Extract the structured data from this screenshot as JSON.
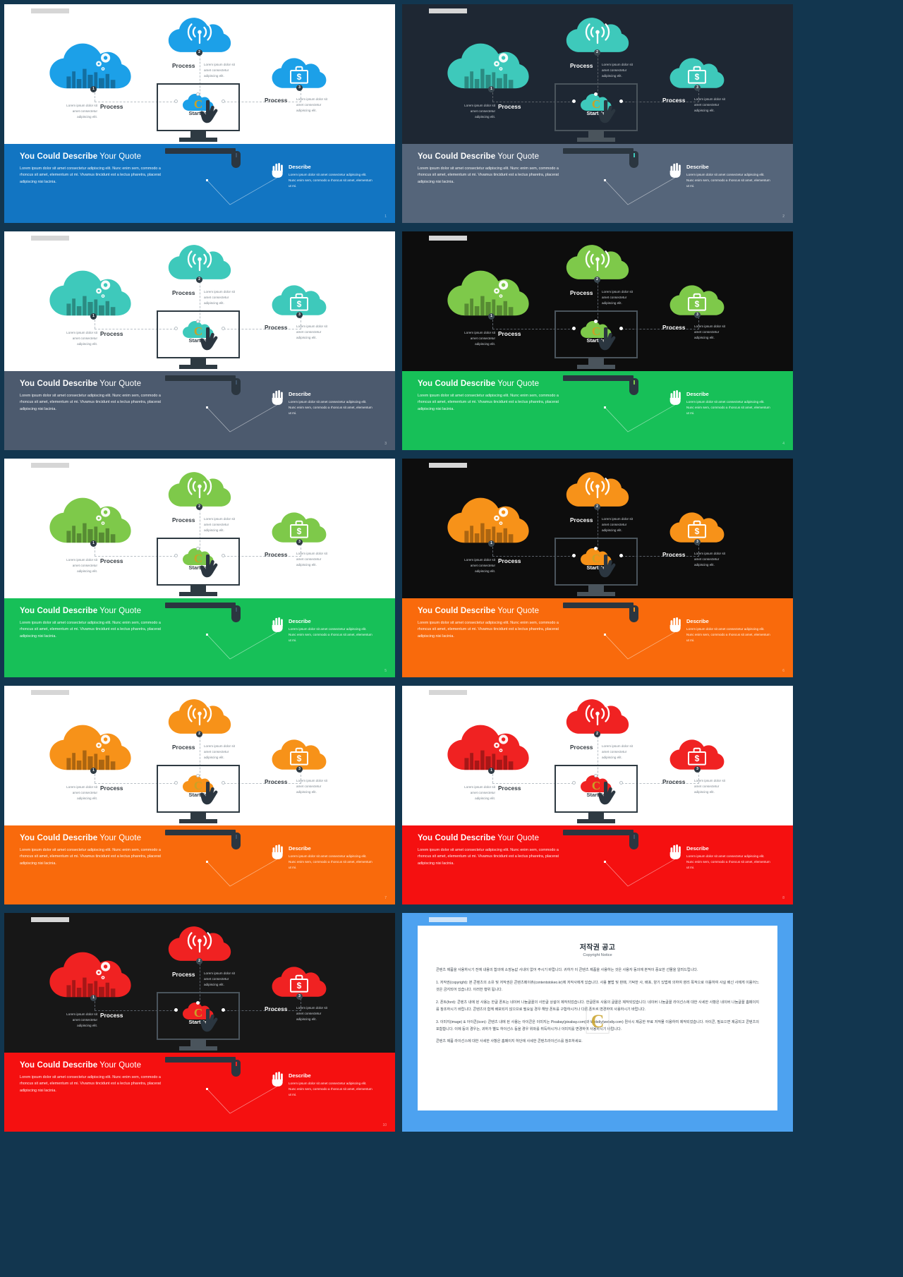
{
  "meta": {
    "background": "#12364f",
    "grid": {
      "columns": 2,
      "rows": 5,
      "total_slides": 10
    }
  },
  "common": {
    "quote": {
      "title_bold": "You Could Describe",
      "title_rest": " Your Quote",
      "body": "Lorem ipsum dolor sit amet consectetur adipiscing elit. Nunc enim sem, commodo a rhoncus sit amet, elementum ut mi. Vivamus tincidunt est a lectus pharetra, placerat adipiscing nisi lacinia."
    },
    "describe": {
      "title": "Describe",
      "body": "Lorem ipsum dolor sit amet consectetur adipiscing elit. Nunc enim sem, commodo a rhoncus sit amet, elementum ut mi.",
      "icon": "hand-icon"
    },
    "monitor_label": "StartUp",
    "monitor_logo": "C",
    "processes": [
      {
        "number": "1",
        "label": "Process",
        "body": "Lorem ipsum dolor sit amet consectetur adipiscing elit.",
        "icon": "gears-city-cloud-icon"
      },
      {
        "number": "2",
        "label": "Process",
        "body": "Lorem ipsum dolor sit amet consectetur adipiscing elit.",
        "icon": "wifi-signal-cloud-icon"
      },
      {
        "number": "3",
        "label": "Process",
        "body": "Lorem ipsum dolor sit amet consectetur adipiscing elit.",
        "icon": "briefcase-dollar-cloud-icon"
      }
    ]
  },
  "slides": [
    {
      "n": 1,
      "theme": "light",
      "canvas_bg": "#ffffff",
      "band_bg": "#1275c2",
      "accent": "#1ca0e8",
      "page": "1"
    },
    {
      "n": 2,
      "theme": "dark",
      "canvas_bg": "#1e2733",
      "band_bg": "#55657a",
      "accent": "#3ec9bb",
      "page": "2"
    },
    {
      "n": 3,
      "theme": "light",
      "canvas_bg": "#ffffff",
      "band_bg": "#4c5a6e",
      "accent": "#3ec9bb",
      "page": "3"
    },
    {
      "n": 4,
      "theme": "dark",
      "canvas_bg": "#0d0d0d",
      "band_bg": "#17c058",
      "accent": "#7ec94a",
      "page": "4"
    },
    {
      "n": 5,
      "theme": "light",
      "canvas_bg": "#ffffff",
      "band_bg": "#17c058",
      "accent": "#7ec94a",
      "page": "5"
    },
    {
      "n": 6,
      "theme": "dark",
      "canvas_bg": "#0d0d0d",
      "band_bg": "#f96a0c",
      "accent": "#f79219",
      "page": "6"
    },
    {
      "n": 7,
      "theme": "light",
      "canvas_bg": "#ffffff",
      "band_bg": "#f96a0c",
      "accent": "#f79219",
      "page": "7"
    },
    {
      "n": 8,
      "theme": "light",
      "canvas_bg": "#ffffff",
      "band_bg": "#f51010",
      "accent": "#f02222",
      "page": "8"
    },
    {
      "n": 9,
      "theme": "dark",
      "canvas_bg": "#171717",
      "band_bg": "#f51010",
      "accent": "#f02222",
      "page": "10"
    }
  ],
  "copyright": {
    "title": "저작권 공고",
    "subtitle": "Copyright Notice",
    "watermark": "C",
    "paragraphs": [
      "콘텐츠 제품을 사용하시기 전에 내용의 합의에 소장능값 사내이 없어 주시기 바랍니다. 귀하가 이 콘텐츠 제품을 사용하는 것은 사용자 동의에 본적이 중요한 선물을 알려드립니다.",
      "1. 저작권(copyright): 본 콘텐츠의 소유 및 저작권은 콘텐츠메이쥬(contentstokeo.kr)에 저작사에게 있습니다. 사용 불법 및 판매, 기탁한 사, 배포, 양기 있법에 의하여 영리 목적으로 이용하여 사실 배신 사에게 이용어느 것은 금지되어 있습니다. 이러한 행위 됩니다.",
      "2. 폰트(font): 콘텐츠 내에 된 사용는 한글 폰트는 네이버 나눔글꼴의 사한글 상설이 제작되었습니다. 한글폰트 사용의 글꼴은 제작되었습니다. 네이버 나눔글꼴 라이선스에 대한 사세한 사항은 네이버 나눔글꼴 홈페이지를 참조하시기 바랍니다. 콘텐츠의 함께 배포되지 않으므로 필요실 경우 해당 폰트를 구합하시거나 다른 폰트로 변경하여 사용하시기 바랍니다.",
      "3. 이미지(image) & 아이콘(icon): 콘텐츠 내에 된 사용는 아이콘은 이미지는 Pixabay(pixabay.com)와 Webdiy(webdiy.com) 뭔사시 제공한 무료 저작물 이용하여 제작되었습니다. 아이콘, 필요으면 제공되고 콘텐츠의 포함합니다. 이에 등의 경우는, 귀하가 별도 하이선스 등을 경우 위와를 취득하시거나 이미지를 변경하여 사용하시기 바랍니다.",
      "콘텐츠 제품 라이선스에 대한 사세한 사항은 홈페이지 하단에 사세한 콘텐츠라이선스를 참조하세요."
    ]
  }
}
